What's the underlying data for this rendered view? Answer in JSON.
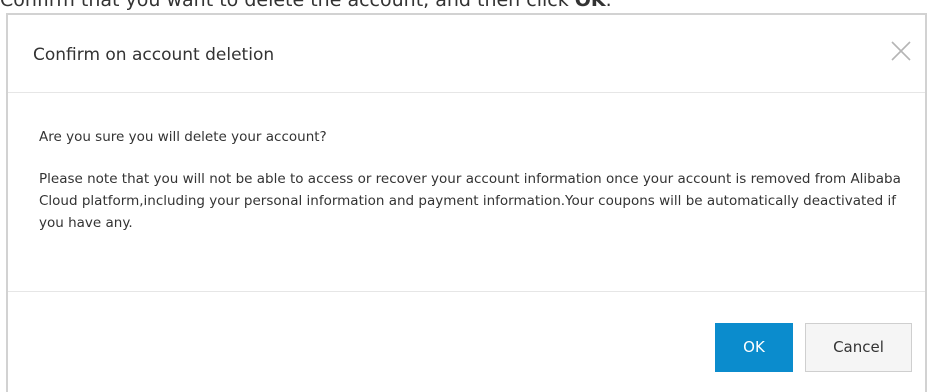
{
  "instruction": {
    "text_before": "Confirm that you want to delete the account, and then click ",
    "text_strong": "OK",
    "text_after": "."
  },
  "dialog": {
    "title": "Confirm on account deletion",
    "close_icon": "close-icon",
    "question": "Are you sure you will delete your account?",
    "note": "Please note that you will not be able to access or recover your account information once your account is removed from Alibaba Cloud platform,including your personal information and payment information.Your coupons will be automatically deactivated if you have any.",
    "ok_label": "OK",
    "cancel_label": "Cancel"
  },
  "colors": {
    "primary": "#0b8ccd",
    "text": "#333333",
    "border": "#d2d2d2",
    "divider": "#e6e6e6"
  }
}
